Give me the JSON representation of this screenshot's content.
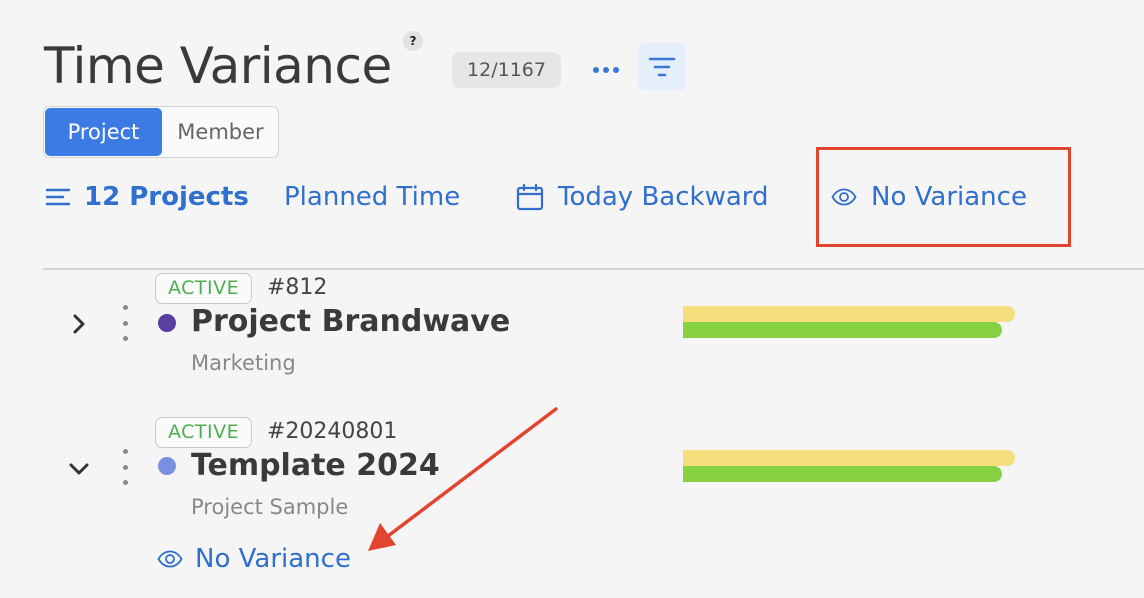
{
  "header": {
    "title": "Time Variance",
    "help_glyph": "?",
    "count_badge": "12/1167"
  },
  "view_toggle": {
    "options": [
      "Project",
      "Member"
    ],
    "selected": "Project"
  },
  "toolbar": {
    "projects_label": "12 Projects",
    "metric_label": "Planned Time",
    "date_label": "Today Backward",
    "variance_label": "No Variance"
  },
  "projects": [
    {
      "status": "ACTIVE",
      "id": "#812",
      "name": "Project Brandwave",
      "client": "Marketing",
      "dot_color": "#5a3fa0",
      "expanded": false,
      "planned_fraction": 1.0,
      "actual_fraction": 0.96
    },
    {
      "status": "ACTIVE",
      "id": "#20240801",
      "name": "Template 2024",
      "client": "Project Sample",
      "dot_color": "#7b8fe0",
      "expanded": true,
      "planned_fraction": 1.0,
      "actual_fraction": 0.96,
      "variance_label": "No Variance"
    }
  ],
  "colors": {
    "accent": "#2f6fcd",
    "active_segment": "#3c7be4",
    "status_active": "#4caf50",
    "planned_bar": "#f7de7c",
    "actual_bar": "#86d243",
    "annotation": "#e2452f"
  }
}
